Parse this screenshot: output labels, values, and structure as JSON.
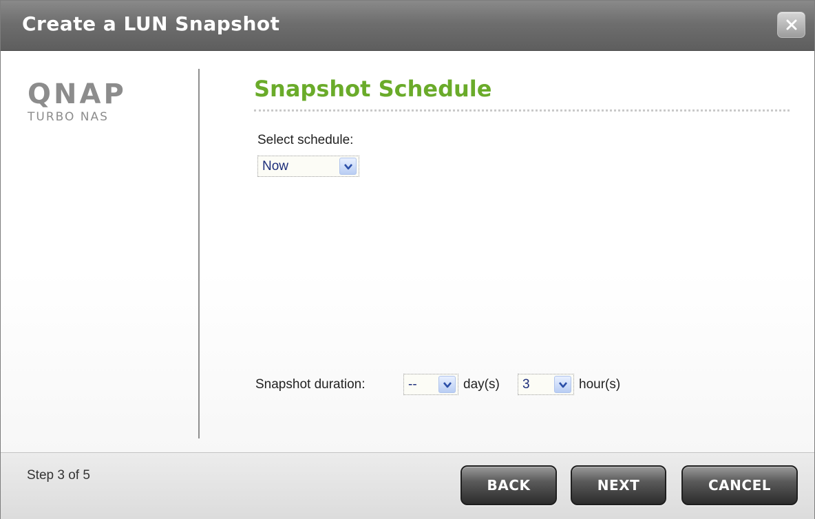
{
  "window": {
    "title": "Create a LUN Snapshot",
    "close_icon": "close-icon"
  },
  "branding": {
    "logo_text": "QNAP",
    "logo_subtitle": "TURBO NAS"
  },
  "main": {
    "section_title": "Snapshot Schedule",
    "schedule_label": "Select schedule:",
    "schedule_value": "Now",
    "duration_label": "Snapshot duration:",
    "duration_days_value": "--",
    "duration_days_unit": "day(s)",
    "duration_hours_value": "3",
    "duration_hours_unit": "hour(s)"
  },
  "footer": {
    "step_text": "Step 3 of 5",
    "back_label": "BACK",
    "next_label": "NEXT",
    "cancel_label": "CANCEL"
  },
  "colors": {
    "accent_green": "#6aab2a",
    "titlebar_gray": "#6e6e6e",
    "select_text_blue": "#1c2d7a"
  }
}
